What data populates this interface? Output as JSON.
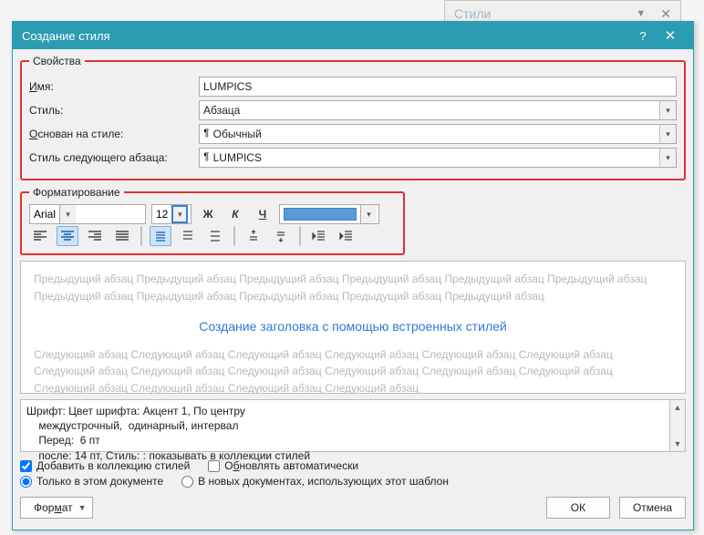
{
  "background_panel": {
    "label": "Стили"
  },
  "dialog": {
    "title": "Создание стиля",
    "properties": {
      "legend": "Свойства",
      "name_label": "Имя:",
      "name_value": "LUMPICS",
      "type_label": "Стиль:",
      "type_value": "Абзаца",
      "based_on_label": "Основан на стиле:",
      "based_on_value": "Обычный",
      "next_label": "Стиль следующего абзаца:",
      "next_value": "LUMPICS"
    },
    "formatting": {
      "legend": "Форматирование",
      "font": "Arial",
      "size": "12",
      "bold": "Ж",
      "italic": "К",
      "underline": "Ч",
      "color": "#5B9BD5",
      "buttons": {
        "align_left": "align-left",
        "align_center": "align-center",
        "align_right": "align-right",
        "align_justify": "align-justify",
        "spacing_1": "line-spacing-1",
        "spacing_15": "line-spacing-1.5",
        "spacing_2": "line-spacing-2",
        "para_before": "space-before",
        "para_after": "space-after",
        "indent_dec": "decrease-indent",
        "indent_inc": "increase-indent"
      }
    },
    "preview": {
      "prev_para": "Предыдущий абзац Предыдущий абзац Предыдущий абзац Предыдущий абзац Предыдущий абзац Предыдущий абзац Предыдущий абзац Предыдущий абзац Предыдущий абзац Предыдущий абзац Предыдущий абзац",
      "sample": "Создание заголовка с помощью встроенных стилей",
      "next_para": "Следующий абзац Следующий абзац Следующий абзац Следующий абзац Следующий абзац Следующий абзац Следующий абзац Следующий абзац Следующий абзац Следующий абзац Следующий абзац Следующий абзац Следующий абзац Следующий абзац Следующий абзац Следующий абзац"
    },
    "description": {
      "line1": "Шрифт: Цвет шрифта: Акцент 1, По центру",
      "line2": "    междустрочный,  одинарный, интервал",
      "line3": "    Перед:  6 пт",
      "line4": "    после: 14 пт, Стиль: : показывать в коллекции стилей"
    },
    "options": {
      "add_to_gallery": "Добавить в коллекцию стилей",
      "auto_update": "Обновлять автоматически",
      "only_this_doc": "Только в этом документе",
      "new_docs": "В новых документах, использующих этот шаблон",
      "add_checked": true,
      "auto_checked": false,
      "only_this_selected": true
    },
    "buttons": {
      "format": "Формат",
      "ok": "ОК",
      "cancel": "Отмена"
    }
  }
}
